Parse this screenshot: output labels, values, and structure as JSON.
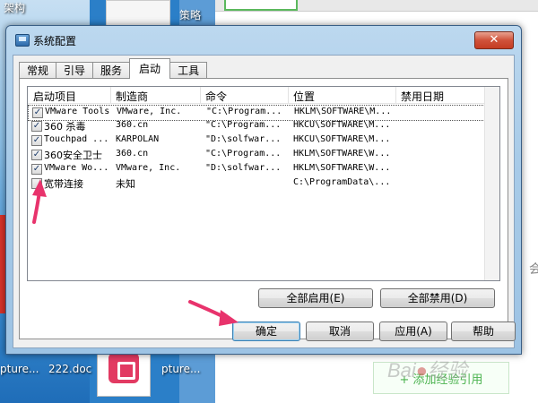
{
  "desktop": {
    "top_label_1": "架构",
    "top_label_2": "策略",
    "left_label": "pture...",
    "doc_label": "222.doc",
    "right_label": "pture..."
  },
  "background_page": {
    "add_button": "+ 添加经验引用",
    "side_char": "会"
  },
  "dialog": {
    "title": "系统配置",
    "close_label": "✕",
    "tabs": [
      "常规",
      "引导",
      "服务",
      "启动",
      "工具"
    ],
    "active_tab": "启动",
    "columns": [
      "启动项目",
      "制造商",
      "命令",
      "位置",
      "禁用日期"
    ],
    "rows": [
      {
        "checked": true,
        "item": "VMware Tools",
        "maker": "VMware, Inc.",
        "command": "\"C:\\Program...",
        "location": "HKLM\\SOFTWARE\\M...",
        "disabled": ""
      },
      {
        "checked": true,
        "item": "360 杀毒",
        "maker": "360.cn",
        "command": "\"C:\\Program...",
        "location": "HKCU\\SOFTWARE\\M...",
        "disabled": ""
      },
      {
        "checked": true,
        "item": "Touchpad ...",
        "maker": "KARPOLAN",
        "command": "\"D:\\solfwar...",
        "location": "HKCU\\SOFTWARE\\M...",
        "disabled": ""
      },
      {
        "checked": true,
        "item": "360安全卫士",
        "maker": "360.cn",
        "command": "\"C:\\Program...",
        "location": "HKLM\\SOFTWARE\\W...",
        "disabled": ""
      },
      {
        "checked": true,
        "item": "VMware Wo...",
        "maker": "VMware, Inc.",
        "command": "\"D:\\solfwar...",
        "location": "HKLM\\SOFTWARE\\W...",
        "disabled": ""
      },
      {
        "checked": false,
        "item": "宽带连接",
        "maker": "未知",
        "command": "",
        "location": "C:\\ProgramData\\...",
        "disabled": ""
      }
    ],
    "enable_all": "全部启用(E)",
    "disable_all": "全部禁用(D)",
    "ok": "确定",
    "cancel": "取消",
    "apply": "应用(A)",
    "help": "帮助"
  },
  "colors": {
    "arrow": "#e8336c",
    "accent_green": "#4bb34f"
  }
}
